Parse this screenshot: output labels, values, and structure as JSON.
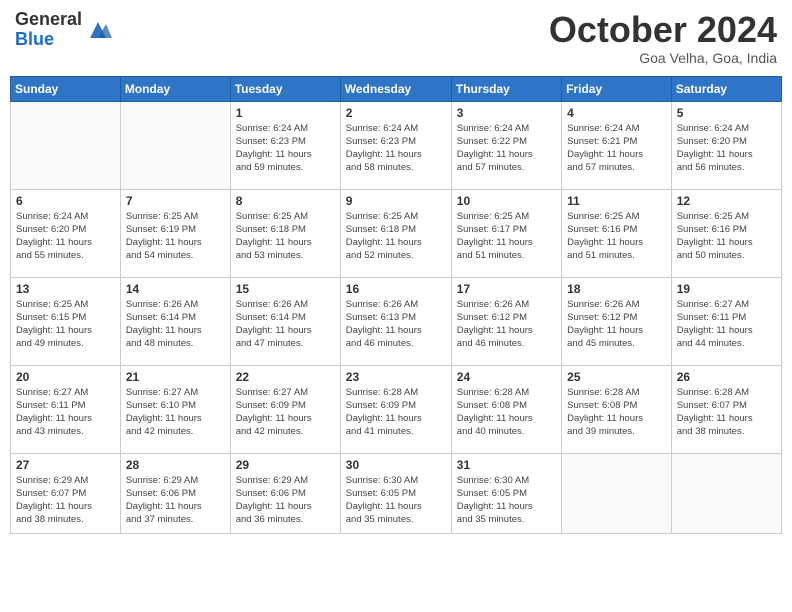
{
  "logo": {
    "general": "General",
    "blue": "Blue"
  },
  "header": {
    "month": "October 2024",
    "location": "Goa Velha, Goa, India"
  },
  "weekdays": [
    "Sunday",
    "Monday",
    "Tuesday",
    "Wednesday",
    "Thursday",
    "Friday",
    "Saturday"
  ],
  "weeks": [
    [
      {
        "day": "",
        "info": ""
      },
      {
        "day": "",
        "info": ""
      },
      {
        "day": "1",
        "info": "Sunrise: 6:24 AM\nSunset: 6:23 PM\nDaylight: 11 hours\nand 59 minutes."
      },
      {
        "day": "2",
        "info": "Sunrise: 6:24 AM\nSunset: 6:23 PM\nDaylight: 11 hours\nand 58 minutes."
      },
      {
        "day": "3",
        "info": "Sunrise: 6:24 AM\nSunset: 6:22 PM\nDaylight: 11 hours\nand 57 minutes."
      },
      {
        "day": "4",
        "info": "Sunrise: 6:24 AM\nSunset: 6:21 PM\nDaylight: 11 hours\nand 57 minutes."
      },
      {
        "day": "5",
        "info": "Sunrise: 6:24 AM\nSunset: 6:20 PM\nDaylight: 11 hours\nand 56 minutes."
      }
    ],
    [
      {
        "day": "6",
        "info": "Sunrise: 6:24 AM\nSunset: 6:20 PM\nDaylight: 11 hours\nand 55 minutes."
      },
      {
        "day": "7",
        "info": "Sunrise: 6:25 AM\nSunset: 6:19 PM\nDaylight: 11 hours\nand 54 minutes."
      },
      {
        "day": "8",
        "info": "Sunrise: 6:25 AM\nSunset: 6:18 PM\nDaylight: 11 hours\nand 53 minutes."
      },
      {
        "day": "9",
        "info": "Sunrise: 6:25 AM\nSunset: 6:18 PM\nDaylight: 11 hours\nand 52 minutes."
      },
      {
        "day": "10",
        "info": "Sunrise: 6:25 AM\nSunset: 6:17 PM\nDaylight: 11 hours\nand 51 minutes."
      },
      {
        "day": "11",
        "info": "Sunrise: 6:25 AM\nSunset: 6:16 PM\nDaylight: 11 hours\nand 51 minutes."
      },
      {
        "day": "12",
        "info": "Sunrise: 6:25 AM\nSunset: 6:16 PM\nDaylight: 11 hours\nand 50 minutes."
      }
    ],
    [
      {
        "day": "13",
        "info": "Sunrise: 6:25 AM\nSunset: 6:15 PM\nDaylight: 11 hours\nand 49 minutes."
      },
      {
        "day": "14",
        "info": "Sunrise: 6:26 AM\nSunset: 6:14 PM\nDaylight: 11 hours\nand 48 minutes."
      },
      {
        "day": "15",
        "info": "Sunrise: 6:26 AM\nSunset: 6:14 PM\nDaylight: 11 hours\nand 47 minutes."
      },
      {
        "day": "16",
        "info": "Sunrise: 6:26 AM\nSunset: 6:13 PM\nDaylight: 11 hours\nand 46 minutes."
      },
      {
        "day": "17",
        "info": "Sunrise: 6:26 AM\nSunset: 6:12 PM\nDaylight: 11 hours\nand 46 minutes."
      },
      {
        "day": "18",
        "info": "Sunrise: 6:26 AM\nSunset: 6:12 PM\nDaylight: 11 hours\nand 45 minutes."
      },
      {
        "day": "19",
        "info": "Sunrise: 6:27 AM\nSunset: 6:11 PM\nDaylight: 11 hours\nand 44 minutes."
      }
    ],
    [
      {
        "day": "20",
        "info": "Sunrise: 6:27 AM\nSunset: 6:11 PM\nDaylight: 11 hours\nand 43 minutes."
      },
      {
        "day": "21",
        "info": "Sunrise: 6:27 AM\nSunset: 6:10 PM\nDaylight: 11 hours\nand 42 minutes."
      },
      {
        "day": "22",
        "info": "Sunrise: 6:27 AM\nSunset: 6:09 PM\nDaylight: 11 hours\nand 42 minutes."
      },
      {
        "day": "23",
        "info": "Sunrise: 6:28 AM\nSunset: 6:09 PM\nDaylight: 11 hours\nand 41 minutes."
      },
      {
        "day": "24",
        "info": "Sunrise: 6:28 AM\nSunset: 6:08 PM\nDaylight: 11 hours\nand 40 minutes."
      },
      {
        "day": "25",
        "info": "Sunrise: 6:28 AM\nSunset: 6:08 PM\nDaylight: 11 hours\nand 39 minutes."
      },
      {
        "day": "26",
        "info": "Sunrise: 6:28 AM\nSunset: 6:07 PM\nDaylight: 11 hours\nand 38 minutes."
      }
    ],
    [
      {
        "day": "27",
        "info": "Sunrise: 6:29 AM\nSunset: 6:07 PM\nDaylight: 11 hours\nand 38 minutes."
      },
      {
        "day": "28",
        "info": "Sunrise: 6:29 AM\nSunset: 6:06 PM\nDaylight: 11 hours\nand 37 minutes."
      },
      {
        "day": "29",
        "info": "Sunrise: 6:29 AM\nSunset: 6:06 PM\nDaylight: 11 hours\nand 36 minutes."
      },
      {
        "day": "30",
        "info": "Sunrise: 6:30 AM\nSunset: 6:05 PM\nDaylight: 11 hours\nand 35 minutes."
      },
      {
        "day": "31",
        "info": "Sunrise: 6:30 AM\nSunset: 6:05 PM\nDaylight: 11 hours\nand 35 minutes."
      },
      {
        "day": "",
        "info": ""
      },
      {
        "day": "",
        "info": ""
      }
    ]
  ]
}
